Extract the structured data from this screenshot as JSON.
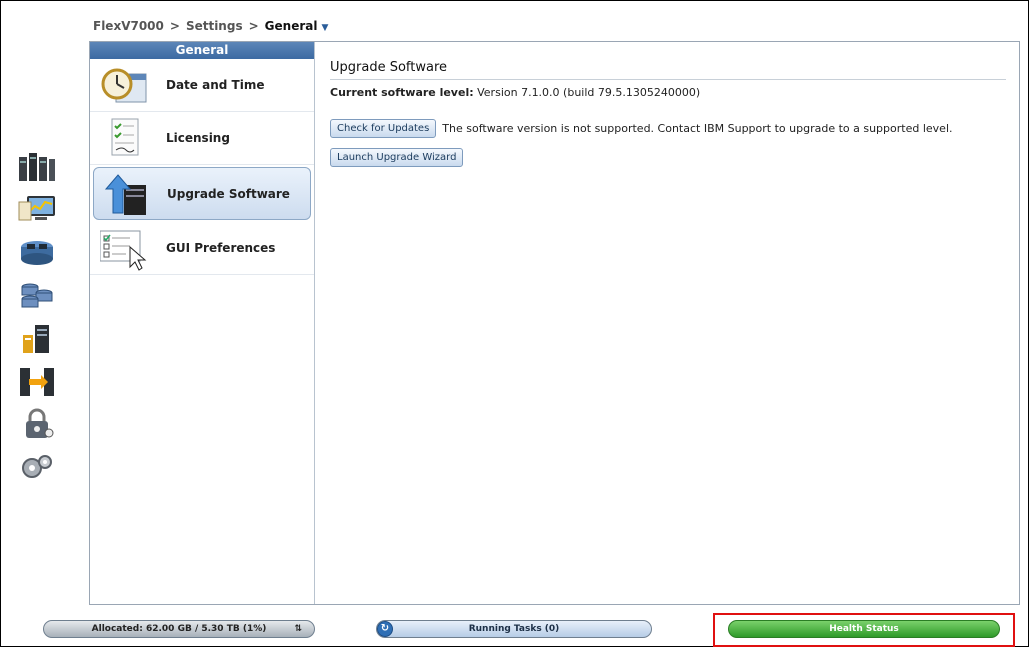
{
  "breadcrumb": {
    "items": [
      "FlexV7000",
      "Settings",
      "General"
    ],
    "separator": ">",
    "dropdown_icon": "caret-down-icon"
  },
  "rail": {
    "icons": [
      "home-icon",
      "monitoring-icon",
      "pools-icon",
      "volumes-icon",
      "hosts-icon",
      "copy-services-icon",
      "access-icon",
      "settings-icon"
    ]
  },
  "nav": {
    "header": "General",
    "items": [
      {
        "label": "Date and Time",
        "icon": "clock-icon"
      },
      {
        "label": "Licensing",
        "icon": "license-icon"
      },
      {
        "label": "Upgrade Software",
        "icon": "upgrade-icon",
        "selected": true
      },
      {
        "label": "GUI Preferences",
        "icon": "preferences-icon"
      }
    ]
  },
  "content": {
    "title": "Upgrade Software",
    "current_level_label": "Current software level:",
    "current_level_value": " Version 7.1.0.0 (build 79.5.1305240000)",
    "check_updates_label": "Check for Updates",
    "unsupported_message": "The software version is not supported. Contact IBM Support to upgrade to a supported level.",
    "launch_wizard_label": "Launch Upgrade Wizard"
  },
  "statusbar": {
    "allocated": "Allocated: 62.00 GB / 5.30 TB (1%)",
    "running_tasks": "Running Tasks (0)",
    "health": "Health Status"
  },
  "colors": {
    "accent": "#3c6aa2",
    "health_green": "#2f9a2a",
    "highlight_red": "#e01010"
  }
}
